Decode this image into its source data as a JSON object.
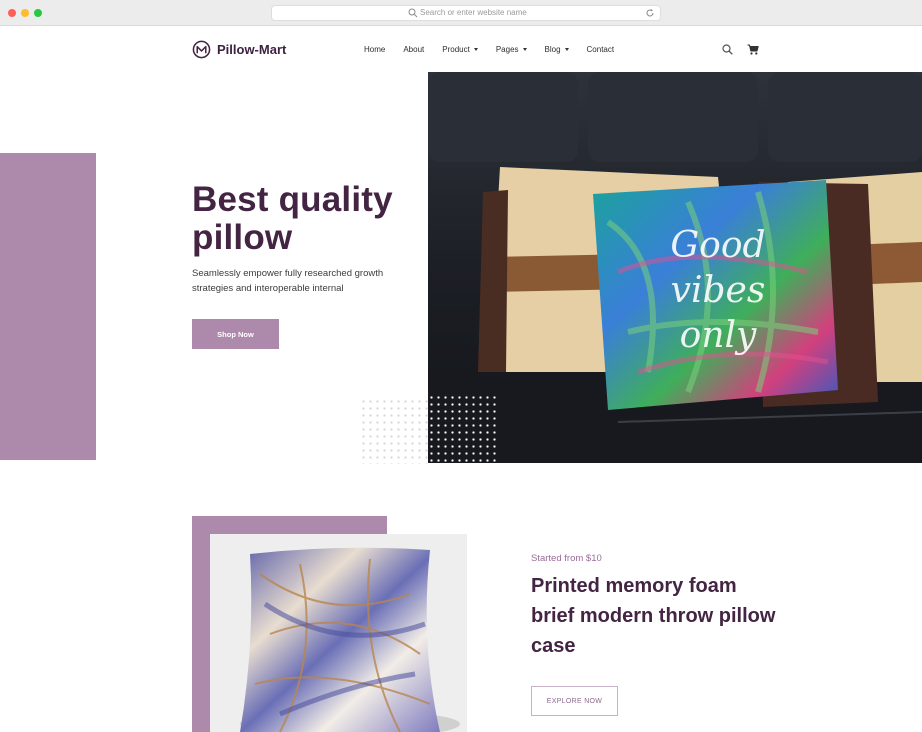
{
  "browser": {
    "url_placeholder": "Search or enter website name"
  },
  "brand": {
    "name": "Pillow-Mart",
    "accent": "#ad89ac",
    "dark": "#432543"
  },
  "nav": {
    "items": [
      {
        "label": "Home",
        "dropdown": false
      },
      {
        "label": "About",
        "dropdown": false
      },
      {
        "label": "Product",
        "dropdown": true
      },
      {
        "label": "Pages",
        "dropdown": true
      },
      {
        "label": "Blog",
        "dropdown": true
      },
      {
        "label": "Contact",
        "dropdown": false
      }
    ],
    "icons": [
      "search-icon",
      "cart-icon"
    ]
  },
  "hero": {
    "title": "Best quality pillow",
    "subtitle": "Seamlessly empower fully researched growth strategies and interoperable internal",
    "cta": "Shop Now",
    "pillow_text": "Good vibes only"
  },
  "feature": {
    "price_note": "Started from $10",
    "title": "Printed memory foam brief modern throw pillow case",
    "cta": "EXPLORE NOW"
  }
}
